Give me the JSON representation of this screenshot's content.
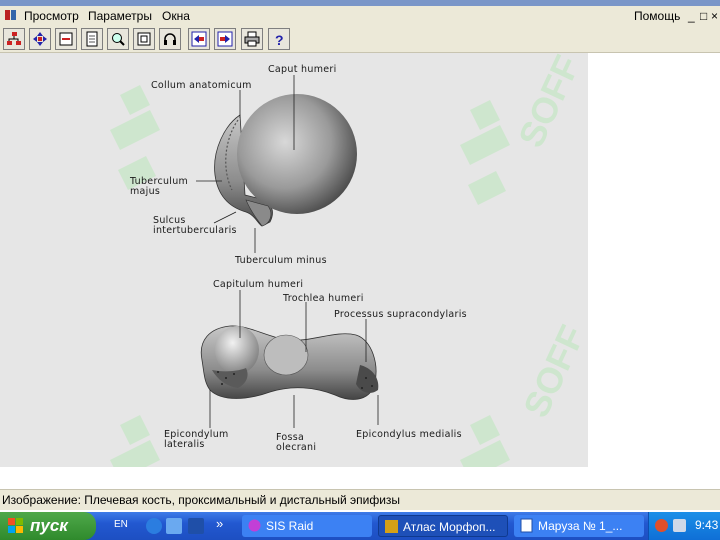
{
  "menu": {
    "items": [
      "Просмотр",
      "Параметры",
      "Окна"
    ],
    "help": "Помощь",
    "min": "_",
    "max": "□",
    "close": "×"
  },
  "toolbar": {
    "buttons": [
      "tree-icon",
      "move-icon",
      "index-icon",
      "page-icon",
      "search-icon",
      "frame-icon",
      "headphones-icon",
      "back-icon",
      "forward-icon",
      "print-icon",
      "help-icon"
    ]
  },
  "watermark": "SOFF",
  "illustration": {
    "labels": {
      "caput_humeri": "Caput humeri",
      "collum_anatomicum": "Collum anatomicum",
      "tuberculum_majus_1": "Tuberculum",
      "tuberculum_majus_2": "majus",
      "sulcus_1": "Sulcus",
      "sulcus_2": "intertubercularis",
      "tuberculum_minus": "Tuberculum minus",
      "capitulum_humeri": "Capitulum humeri",
      "trochlea_humeri": "Trochlea humeri",
      "processus_supracondylaris": "Processus supracondylaris",
      "epicondylum_1": "Epicondylum",
      "epicondylum_2": "lateralis",
      "fossa_1": "Fossa",
      "fossa_2": "olecrani",
      "epicondylus_medialis": "Epicondylus medialis"
    }
  },
  "status": {
    "text": "Изображение: Плечевая кость, проксимальный и дистальный эпифизы"
  },
  "taskbar": {
    "start_label": "пуск",
    "lang": "EN",
    "chevron": "»",
    "tasks": [
      {
        "label": "SIS Raid"
      },
      {
        "label": "Атлас Морфоп..."
      },
      {
        "label": "Маруза № 1_..."
      }
    ],
    "clock": "9:43"
  },
  "colors": {
    "accent": "#2258d0",
    "start": "#2f8a2c",
    "watermark": "#c6e6c6"
  }
}
